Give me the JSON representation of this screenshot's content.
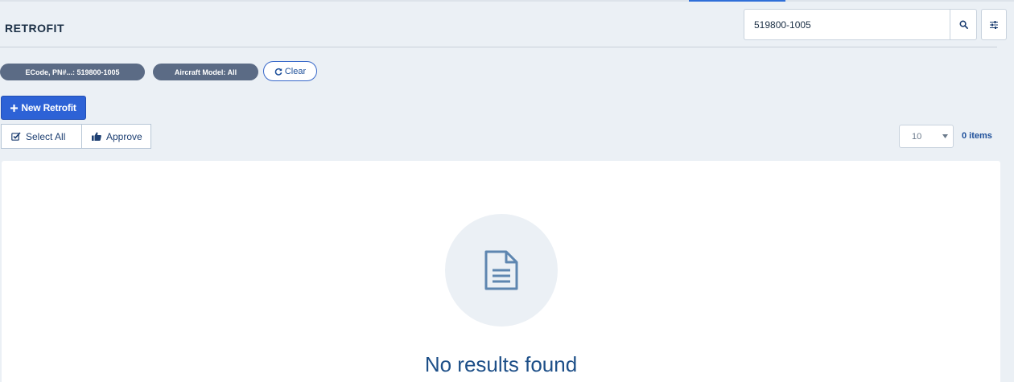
{
  "header": {
    "title": "RETROFIT",
    "search": {
      "value": "519800-1005",
      "icon": "search-icon"
    },
    "filter_icon": "sliders-icon"
  },
  "filters": {
    "chips": [
      {
        "label": "ECode, PN#...: 519800-1005"
      },
      {
        "label": "Aircraft Model: All"
      }
    ],
    "clear_label": "Clear"
  },
  "toolbar": {
    "new_label": "New Retrofit",
    "select_all_label": "Select All",
    "approve_label": "Approve",
    "page_size": "10",
    "items_count": "0 items"
  },
  "results": {
    "empty_text": "No results found",
    "empty_icon": "document-icon"
  },
  "colors": {
    "accent": "#2d62d6",
    "chip": "#5b6b85",
    "background": "#ebf0f5",
    "text_dark": "#1d4f88"
  }
}
